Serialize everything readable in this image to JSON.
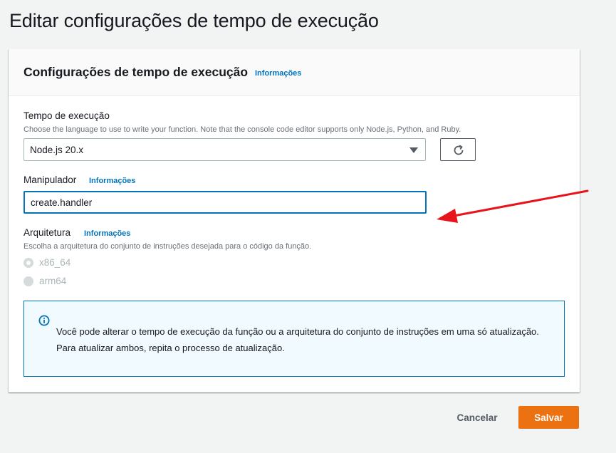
{
  "page": {
    "title": "Editar configurações de tempo de execução"
  },
  "card": {
    "title": "Configurações de tempo de execução",
    "info_label": "Informações"
  },
  "runtime": {
    "label": "Tempo de execução",
    "description": "Choose the language to use to write your function. Note that the console code editor supports only Node.js, Python, and Ruby.",
    "selected": "Node.js 20.x",
    "refresh_icon": "refresh-icon"
  },
  "handler": {
    "label": "Manipulador",
    "info_label": "Informações",
    "value": "create.handler"
  },
  "architecture": {
    "label": "Arquitetura",
    "info_label": "Informações",
    "description": "Escolha a arquitetura do conjunto de instruções desejada para o código da função.",
    "options": [
      {
        "label": "x86_64",
        "checked": true
      },
      {
        "label": "arm64",
        "checked": false
      }
    ]
  },
  "alert": {
    "icon": "info-icon",
    "text": "Você pode alterar o tempo de execução da função ou a arquitetura do conjunto de instruções em uma só atualização. Para atualizar ambos, repita o processo de atualização."
  },
  "actions": {
    "cancel_label": "Cancelar",
    "save_label": "Salvar"
  },
  "colors": {
    "accent": "#0073bb",
    "primary_button": "#ec7211",
    "annotation_arrow": "#e8141c"
  }
}
